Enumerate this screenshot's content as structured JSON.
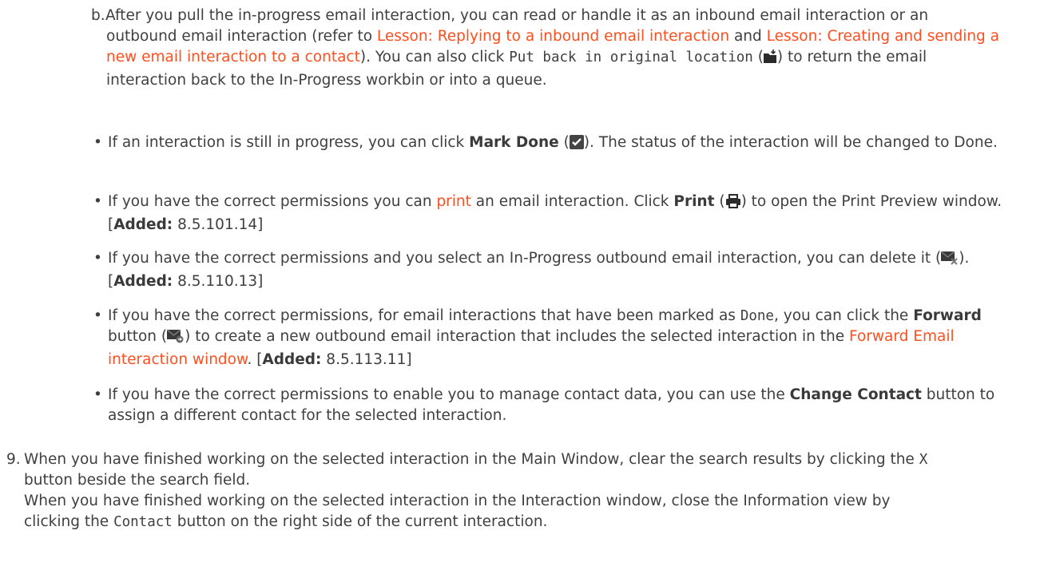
{
  "step_b": {
    "marker": "b.",
    "text1": "After you pull the in-progress email interaction, you can read or handle it as an inbound email",
    "text2": "interaction or an outbound email interaction (refer to ",
    "link1": "Lesson: Replying to a inbound email interaction",
    "text3": " and ",
    "link2": "Lesson: Creating and sending a new email interaction to a contact",
    "text4": "). You can also click ",
    "code": "Put back in original location",
    "text5": " (",
    "icon": "folder-putback-icon",
    "text6": ") to return the email interaction back to the In-Progress workbin or into a queue."
  },
  "bullets": [
    {
      "pre": "If an interaction is still in progress, you can click ",
      "bold": "Mark Done",
      "mid": " (",
      "icon": "checkmark-icon",
      "post": "). The status of the interaction will be changed to Done."
    },
    {
      "pre": "If you have the correct permissions you can ",
      "link": "print",
      "mid1": " an email interaction. Click ",
      "bold": "Print",
      "mid2": " (",
      "icon": "printer-icon",
      "post": ") to open the Print Preview window. [",
      "added_label": "Added:",
      "added_version": " 8.5.101.14]"
    },
    {
      "pre": "If you have the correct permissions and you select an In-Progress outbound email interaction, you can delete it (",
      "icon": "delete-email-icon",
      "post": "). [",
      "added_label": "Added:",
      "added_version": " 8.5.110.13]"
    },
    {
      "pre": "If you have the correct permissions, for email interactions that have been marked as ",
      "code": "Done",
      "mid1": ", you can click the ",
      "bold": "Forward",
      "mid2": " button (",
      "icon": "forward-email-icon",
      "post1": ") to create a new outbound email interaction that includes the selected interaction in the ",
      "link": "Forward Email interaction window",
      "post2": ". [",
      "added_label": "Added:",
      "added_version": " 8.5.113.11]"
    },
    {
      "pre": "If you have the correct permissions to enable you to manage contact data, you can use the ",
      "bold": "Change Contact",
      "post": " button to assign a different contact for the selected interaction."
    }
  ],
  "step_9": {
    "marker": "9.",
    "text1": "When you have finished working on the selected interaction in the Main Window, clear the search results by clicking the ",
    "code1": "X",
    "text2": " button beside the search field.",
    "text3": "When you have finished working on the selected interaction in the Interaction window, close the Information view by clicking the ",
    "code2": "Contact",
    "text4": " button on the right side of the current interaction."
  },
  "colors": {
    "link": "#ff4f1f",
    "text": "#3f3f3f",
    "icon": "#2b2b2b"
  }
}
